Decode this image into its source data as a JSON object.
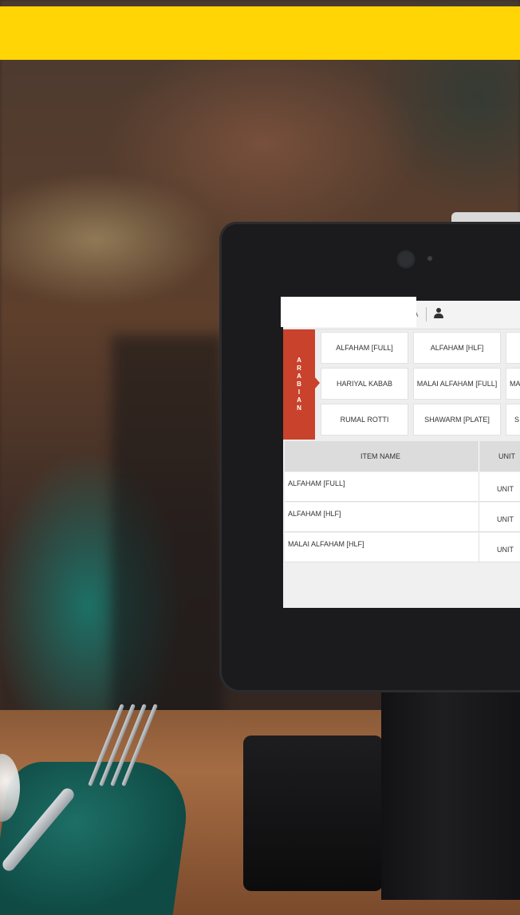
{
  "banner": {
    "color": "#ffd505"
  },
  "screen": {
    "status_text": "IA",
    "category": {
      "label": "ARABIAN",
      "color": "#c9422b"
    },
    "menu_tiles": [
      [
        "ALFAHAM [FULL]",
        "ALFAHAM [HLF]"
      ],
      [
        "HARIYAL KABAB",
        "MALAI ALFAHAM [FULL]",
        "MA"
      ],
      [
        "RUMAL ROTTI",
        "SHAWARM [PLATE]",
        "S"
      ]
    ],
    "order_table": {
      "columns": [
        "ITEM NAME",
        "UNIT"
      ],
      "rows": [
        {
          "name": "ALFAHAM [FULL]",
          "unit": "UNIT"
        },
        {
          "name": "ALFAHAM [HLF]",
          "unit": "UNIT"
        },
        {
          "name": "MALAI ALFAHAM [HLF]",
          "unit": "UNIT"
        }
      ]
    }
  },
  "icons": [
    "user-icon",
    "camera-icon"
  ]
}
